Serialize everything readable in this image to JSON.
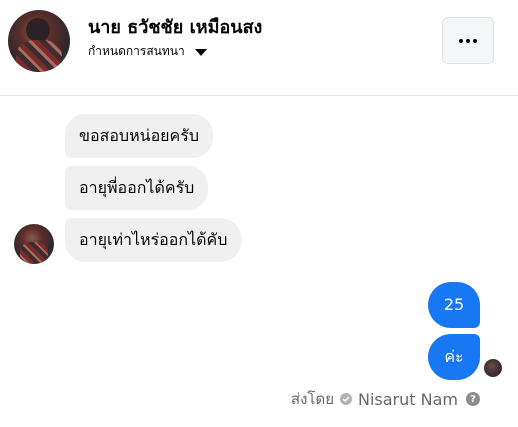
{
  "header": {
    "contact_name": "นาย ธวัชชัย เหมือนสง",
    "nickname_label": "กำหนดการสนทนา",
    "more_icon": "more-horizontal-icon"
  },
  "messages": {
    "incoming": [
      {
        "text": "ขอสอบหน่อยครับ"
      },
      {
        "text": "อายุพี่ออกได้ครับ"
      },
      {
        "text": "อายุเท่าไหร่ออกได้คับ"
      }
    ],
    "outgoing": [
      {
        "text": "25"
      },
      {
        "text": "ค่ะ"
      }
    ]
  },
  "footer": {
    "sent_by_label": "ส่งโดย",
    "sender_name": "Nisarut Nam",
    "help_glyph": "?",
    "check_icon": "check-circle-icon",
    "help_icon": "question-circle-icon"
  },
  "colors": {
    "outgoing_bubble": "#1877f2",
    "incoming_bubble": "#f0f0f0",
    "secondary_text": "#65676b"
  }
}
